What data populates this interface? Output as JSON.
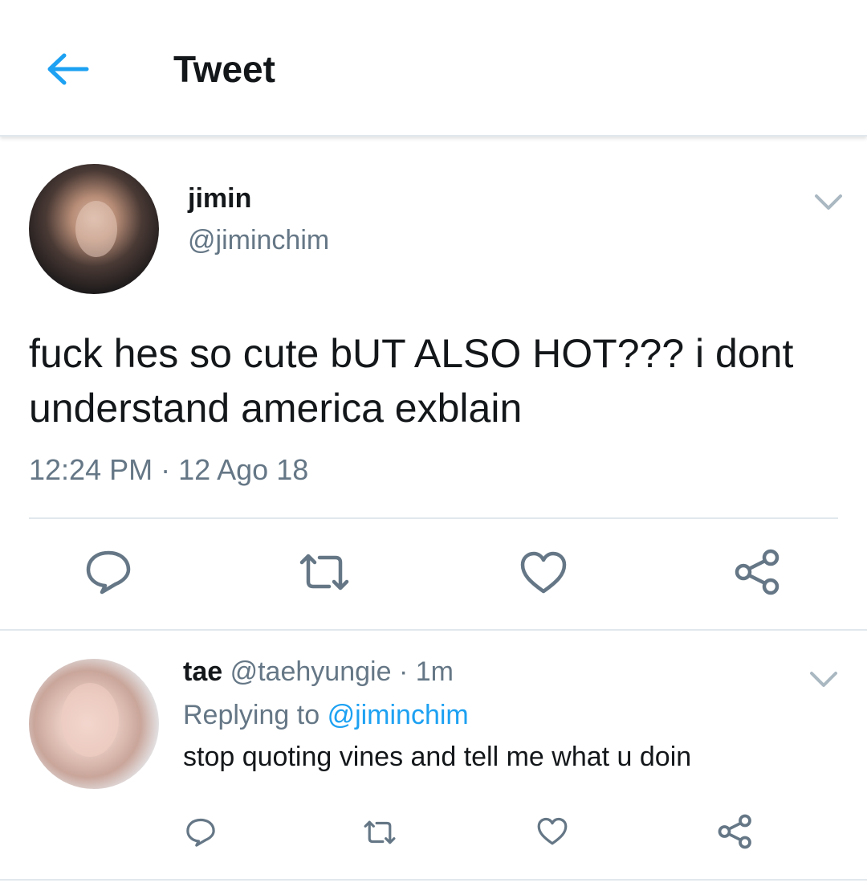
{
  "header": {
    "title": "Tweet",
    "back_icon": "arrow-left-icon",
    "accent_color": "#1da1f2"
  },
  "main_tweet": {
    "name": "jimin",
    "handle": "@jiminchim",
    "text": "fuck hes so cute bUT ALSO HOT??? i dont understand america exblain",
    "timestamp": "12:24 PM · 12 Ago 18",
    "actions": [
      "reply-icon",
      "retweet-icon",
      "like-icon",
      "share-icon"
    ]
  },
  "reply": {
    "name": "tae",
    "handle": "@taehyungie",
    "separator": "·",
    "time": "1m",
    "replying_prefix": "Replying to",
    "replying_handle": "@jiminchim",
    "text": "stop quoting vines and tell me what u doin",
    "actions": [
      "reply-icon",
      "retweet-icon",
      "like-icon",
      "share-icon"
    ]
  },
  "colors": {
    "text_primary": "#14171a",
    "text_secondary": "#657786",
    "link": "#1da1f2",
    "divider": "#e1e8ed",
    "icon_gray": "#657786"
  }
}
